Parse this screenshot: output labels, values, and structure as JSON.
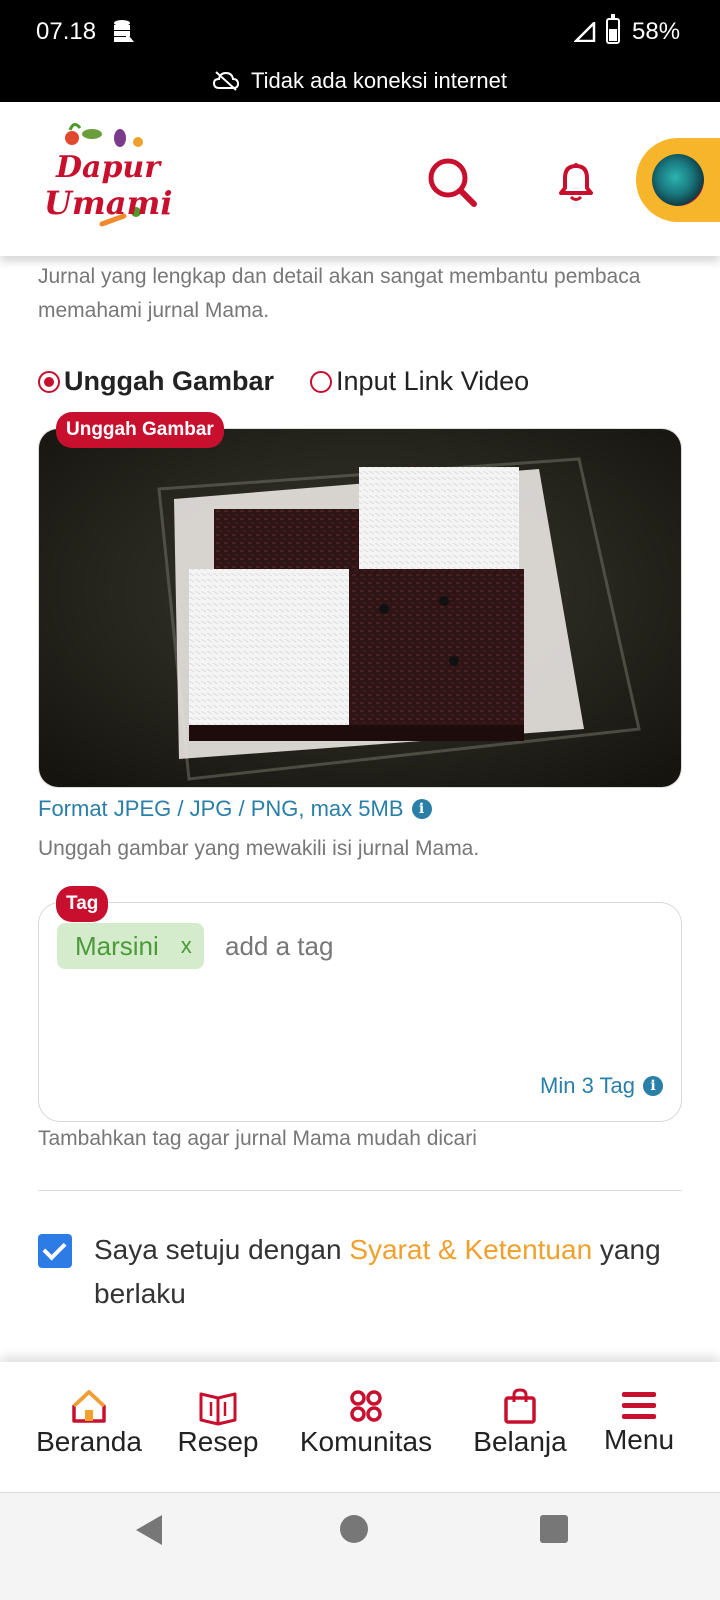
{
  "status_bar": {
    "time": "07.18",
    "battery": "58%",
    "battery_level": 0.58,
    "network_message": "Tidak ada koneksi internet"
  },
  "header": {
    "logo_line1": "Dapur",
    "logo_line2": "Umami",
    "icons": [
      "search-icon",
      "bell-icon",
      "avatar"
    ],
    "accent_color": "#c8102e",
    "avatar_bg": "#f7b52c"
  },
  "form": {
    "journal_helper": "Jurnal yang lengkap dan detail akan sangat membantu pembaca memahami jurnal Mama.",
    "media_options": [
      {
        "label": "Unggah Gambar",
        "selected": true
      },
      {
        "label": "Input Link Video",
        "selected": false
      }
    ],
    "image_badge": "Unggah Gambar",
    "format_note": "Format JPEG / JPG / PNG, max 5MB",
    "upload_helper": "Unggah gambar yang mewakili isi jurnal Mama.",
    "tag_badge": "Tag",
    "tags": [
      {
        "label": "Marsini",
        "remove": "x"
      }
    ],
    "tag_placeholder": "add a tag",
    "min_tag_note": "Min 3 Tag",
    "tag_helper": "Tambahkan tag agar jurnal Mama mudah dicari",
    "agree_prefix": "Saya setuju dengan ",
    "agree_link": "Syarat & Ketentuan",
    "agree_suffix": " yang berlaku",
    "agree_checked": true
  },
  "bottom_nav": [
    {
      "label": "Beranda",
      "icon": "home-icon",
      "active": true
    },
    {
      "label": "Resep",
      "icon": "recipe-book-icon"
    },
    {
      "label": "Komunitas",
      "icon": "community-icon"
    },
    {
      "label": "Belanja",
      "icon": "shopping-bag-icon"
    },
    {
      "label": "Menu",
      "icon": "hamburger-menu-icon"
    }
  ],
  "system_nav": [
    "back-icon",
    "home-circle-icon",
    "recents-icon"
  ]
}
